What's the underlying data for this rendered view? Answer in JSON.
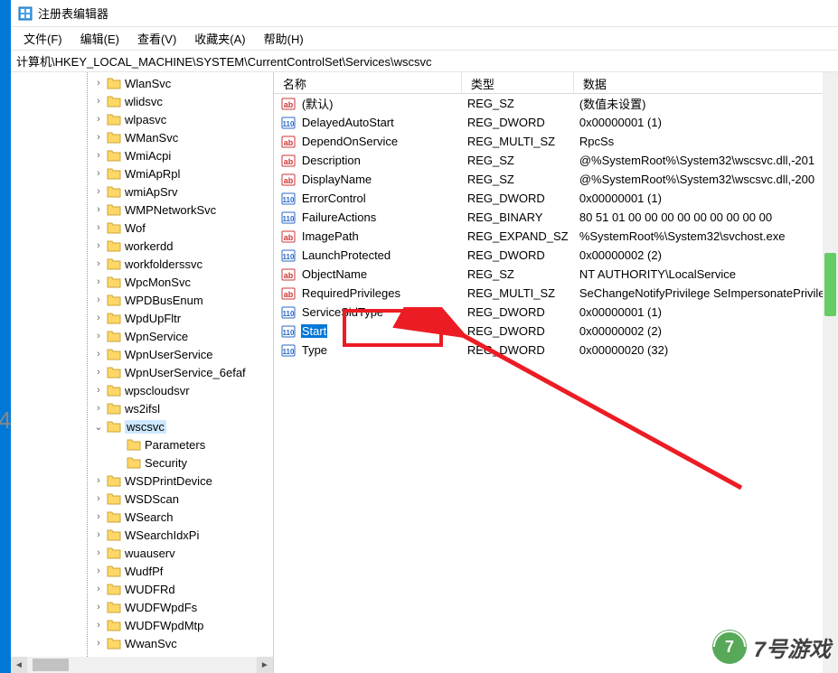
{
  "frame_bg_number": "4",
  "title": "注册表编辑器",
  "menu": {
    "items": [
      "文件(F)",
      "编辑(E)",
      "查看(V)",
      "收藏夹(A)",
      "帮助(H)"
    ]
  },
  "address": "计算机\\HKEY_LOCAL_MACHINE\\SYSTEM\\CurrentControlSet\\Services\\wscsvc",
  "tree": {
    "items": [
      {
        "expand": "closed",
        "label": "WlanSvc"
      },
      {
        "expand": "closed",
        "label": "wlidsvc"
      },
      {
        "expand": "closed",
        "label": "wlpasvc"
      },
      {
        "expand": "closed",
        "label": "WManSvc"
      },
      {
        "expand": "closed",
        "label": "WmiAcpi"
      },
      {
        "expand": "closed",
        "label": "WmiApRpl"
      },
      {
        "expand": "closed",
        "label": "wmiApSrv"
      },
      {
        "expand": "closed",
        "label": "WMPNetworkSvc"
      },
      {
        "expand": "closed",
        "label": "Wof"
      },
      {
        "expand": "closed",
        "label": "workerdd"
      },
      {
        "expand": "closed",
        "label": "workfolderssvc"
      },
      {
        "expand": "closed",
        "label": "WpcMonSvc"
      },
      {
        "expand": "closed",
        "label": "WPDBusEnum"
      },
      {
        "expand": "closed",
        "label": "WpdUpFltr"
      },
      {
        "expand": "closed",
        "label": "WpnService"
      },
      {
        "expand": "closed",
        "label": "WpnUserService"
      },
      {
        "expand": "closed",
        "label": "WpnUserService_6efaf"
      },
      {
        "expand": "closed",
        "label": "wpscloudsvr"
      },
      {
        "expand": "closed",
        "label": "ws2ifsl"
      },
      {
        "expand": "open",
        "label": "wscsvc",
        "selected": true
      },
      {
        "expand": "none",
        "label": "Parameters",
        "depth": 1
      },
      {
        "expand": "none",
        "label": "Security",
        "depth": 1
      },
      {
        "expand": "closed",
        "label": "WSDPrintDevice"
      },
      {
        "expand": "closed",
        "label": "WSDScan"
      },
      {
        "expand": "closed",
        "label": "WSearch"
      },
      {
        "expand": "closed",
        "label": "WSearchIdxPi"
      },
      {
        "expand": "closed",
        "label": "wuauserv"
      },
      {
        "expand": "closed",
        "label": "WudfPf"
      },
      {
        "expand": "closed",
        "label": "WUDFRd"
      },
      {
        "expand": "closed",
        "label": "WUDFWpdFs"
      },
      {
        "expand": "closed",
        "label": "WUDFWpdMtp"
      },
      {
        "expand": "closed",
        "label": "WwanSvc"
      }
    ]
  },
  "list": {
    "headers": {
      "name": "名称",
      "type": "类型",
      "data": "数据"
    },
    "rows": [
      {
        "icon": "str",
        "name": "(默认)",
        "type": "REG_SZ",
        "data": "(数值未设置)"
      },
      {
        "icon": "bin",
        "name": "DelayedAutoStart",
        "type": "REG_DWORD",
        "data": "0x00000001 (1)"
      },
      {
        "icon": "str",
        "name": "DependOnService",
        "type": "REG_MULTI_SZ",
        "data": "RpcSs"
      },
      {
        "icon": "str",
        "name": "Description",
        "type": "REG_SZ",
        "data": "@%SystemRoot%\\System32\\wscsvc.dll,-201"
      },
      {
        "icon": "str",
        "name": "DisplayName",
        "type": "REG_SZ",
        "data": "@%SystemRoot%\\System32\\wscsvc.dll,-200"
      },
      {
        "icon": "bin",
        "name": "ErrorControl",
        "type": "REG_DWORD",
        "data": "0x00000001 (1)"
      },
      {
        "icon": "bin",
        "name": "FailureActions",
        "type": "REG_BINARY",
        "data": "80 51 01 00 00 00 00 00 00 00 00 00"
      },
      {
        "icon": "str",
        "name": "ImagePath",
        "type": "REG_EXPAND_SZ",
        "data": "%SystemRoot%\\System32\\svchost.exe"
      },
      {
        "icon": "bin",
        "name": "LaunchProtected",
        "type": "REG_DWORD",
        "data": "0x00000002 (2)"
      },
      {
        "icon": "str",
        "name": "ObjectName",
        "type": "REG_SZ",
        "data": "NT AUTHORITY\\LocalService"
      },
      {
        "icon": "str",
        "name": "RequiredPrivileges",
        "type": "REG_MULTI_SZ",
        "data": "SeChangeNotifyPrivilege SeImpersonatePrivilege"
      },
      {
        "icon": "bin",
        "name": "ServiceSidType",
        "type": "REG_DWORD",
        "data": "0x00000001 (1)"
      },
      {
        "icon": "bin",
        "name": "Start",
        "type": "REG_DWORD",
        "data": "0x00000002 (2)",
        "selected": true
      },
      {
        "icon": "bin",
        "name": "Type",
        "type": "REG_DWORD",
        "data": "0x00000020 (32)"
      }
    ]
  },
  "watermark": {
    "brand": "7号游戏",
    "sub": "游戏"
  }
}
